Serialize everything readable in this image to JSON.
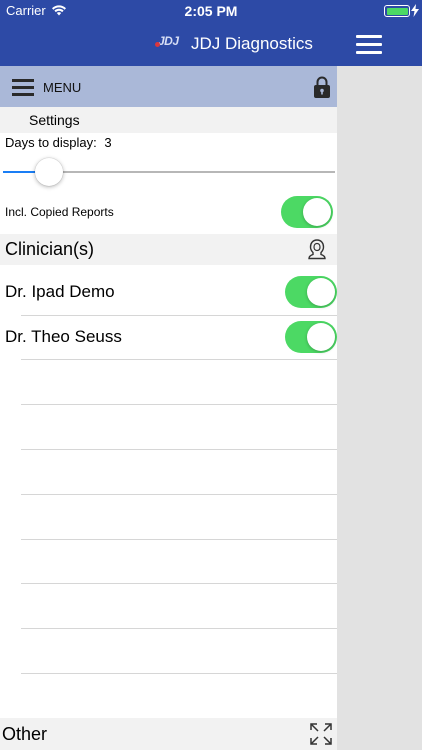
{
  "status_bar": {
    "carrier": "Carrier",
    "time": "2:05 PM"
  },
  "header": {
    "logo_text": "JDJ",
    "title": "JDJ Diagnostics"
  },
  "menu": {
    "label": "MENU"
  },
  "settings": {
    "section_label": "Settings",
    "days_label": "Days to display:",
    "days_value": "3",
    "days_slider_fraction": 0.14,
    "copied_reports_label": "Incl. Copied Reports",
    "copied_reports_on": true
  },
  "clinicians": {
    "header": "Clinician(s)",
    "items": [
      {
        "name": "Dr. Ipad Demo",
        "enabled": true
      },
      {
        "name": "Dr. Theo Seuss",
        "enabled": true
      }
    ]
  },
  "other": {
    "label": "Other"
  },
  "colors": {
    "header_bg": "#2d4aa6",
    "menu_bar_bg": "#aab8d8",
    "toggle_on": "#4cd964",
    "slider_fill": "#1a7ef5"
  },
  "icons": [
    "wifi-icon",
    "battery-icon",
    "jdj-logo",
    "hamburger-icon",
    "lock-icon",
    "clinician-icon",
    "expand-icon"
  ]
}
